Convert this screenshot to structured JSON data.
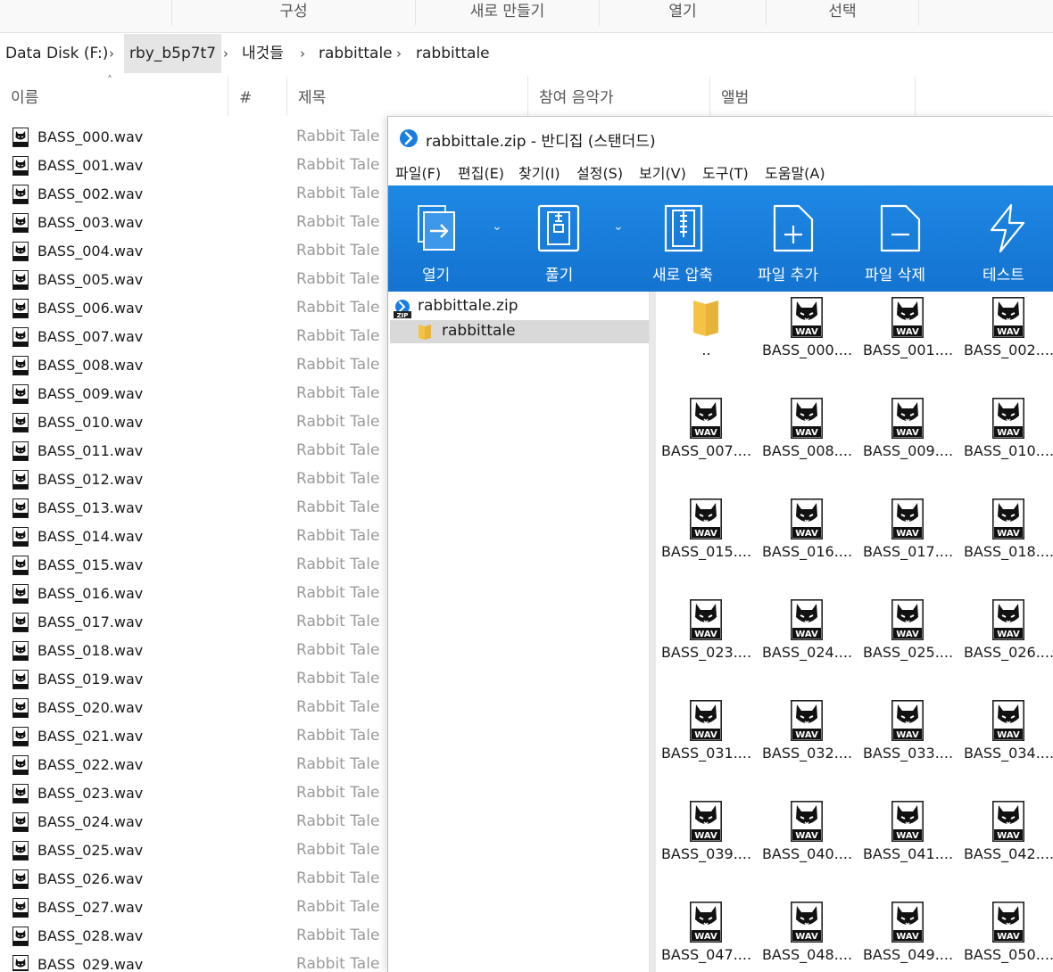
{
  "explorer": {
    "commands": [
      "구성",
      "새로 만들기",
      "열기",
      "선택"
    ],
    "breadcrumb": [
      "Data Disk (F:)",
      "rby_b5p7t7",
      "내것들",
      "rabbittale",
      "rabbittale"
    ],
    "columns": [
      "이름",
      "#",
      "제목",
      "참여 음악가",
      "앨범"
    ],
    "files": [
      {
        "name": "BASS_000.wav",
        "title": "Rabbit Tale"
      },
      {
        "name": "BASS_001.wav",
        "title": "Rabbit Tale"
      },
      {
        "name": "BASS_002.wav",
        "title": "Rabbit Tale"
      },
      {
        "name": "BASS_003.wav",
        "title": "Rabbit Tale"
      },
      {
        "name": "BASS_004.wav",
        "title": "Rabbit Tale"
      },
      {
        "name": "BASS_005.wav",
        "title": "Rabbit Tale"
      },
      {
        "name": "BASS_006.wav",
        "title": "Rabbit Tale"
      },
      {
        "name": "BASS_007.wav",
        "title": "Rabbit Tale"
      },
      {
        "name": "BASS_008.wav",
        "title": "Rabbit Tale"
      },
      {
        "name": "BASS_009.wav",
        "title": "Rabbit Tale"
      },
      {
        "name": "BASS_010.wav",
        "title": "Rabbit Tale"
      },
      {
        "name": "BASS_011.wav",
        "title": "Rabbit Tale"
      },
      {
        "name": "BASS_012.wav",
        "title": "Rabbit Tale"
      },
      {
        "name": "BASS_013.wav",
        "title": "Rabbit Tale"
      },
      {
        "name": "BASS_014.wav",
        "title": "Rabbit Tale"
      },
      {
        "name": "BASS_015.wav",
        "title": "Rabbit Tale"
      },
      {
        "name": "BASS_016.wav",
        "title": "Rabbit Tale"
      },
      {
        "name": "BASS_017.wav",
        "title": "Rabbit Tale"
      },
      {
        "name": "BASS_018.wav",
        "title": "Rabbit Tale"
      },
      {
        "name": "BASS_019.wav",
        "title": "Rabbit Tale"
      },
      {
        "name": "BASS_020.wav",
        "title": "Rabbit Tale"
      },
      {
        "name": "BASS_021.wav",
        "title": "Rabbit Tale"
      },
      {
        "name": "BASS_022.wav",
        "title": "Rabbit Tale"
      },
      {
        "name": "BASS_023.wav",
        "title": "Rabbit Tale"
      },
      {
        "name": "BASS_024.wav",
        "title": "Rabbit Tale"
      },
      {
        "name": "BASS_025.wav",
        "title": "Rabbit Tale"
      },
      {
        "name": "BASS_026.wav",
        "title": "Rabbit Tale"
      },
      {
        "name": "BASS_027.wav",
        "title": "Rabbit Tale"
      },
      {
        "name": "BASS_028.wav",
        "title": "Rabbit Tale"
      },
      {
        "name": "BASS_029.wav",
        "title": "Rabbit Tale"
      }
    ],
    "file_icon": "wav-file-icon"
  },
  "bandizip": {
    "title": "rabbittale.zip - 반디집 (스탠더드)",
    "menu": [
      "파일(F)",
      "편집(E)",
      "찾기(I)",
      "설정(S)",
      "보기(V)",
      "도구(T)",
      "도움말(A)"
    ],
    "toolbar": [
      {
        "label": "열기",
        "icon": "open-icon"
      },
      {
        "label": "풀기",
        "icon": "extract-icon"
      },
      {
        "label": "새로 압축",
        "icon": "new-archive-icon"
      },
      {
        "label": "파일 추가",
        "icon": "add-file-icon"
      },
      {
        "label": "파일 삭제",
        "icon": "delete-file-icon"
      },
      {
        "label": "테스트",
        "icon": "test-icon"
      }
    ],
    "tree": {
      "root": "rabbittale.zip",
      "child": "rabbittale"
    },
    "tiles": [
      "..",
      "BASS_000....",
      "BASS_001....",
      "BASS_002....",
      "BASS_007....",
      "BASS_008....",
      "BASS_009....",
      "BASS_010....",
      "BASS_015....",
      "BASS_016....",
      "BASS_017....",
      "BASS_018....",
      "BASS_023....",
      "BASS_024....",
      "BASS_025....",
      "BASS_026....",
      "BASS_031....",
      "BASS_032....",
      "BASS_033....",
      "BASS_034....",
      "BASS_039....",
      "BASS_040....",
      "BASS_041....",
      "BASS_042....",
      "BASS_047....",
      "BASS_048....",
      "BASS_049....",
      "BASS_050...."
    ],
    "wav_badge": "WAV",
    "colors": {
      "toolbar": "#1a7ee0",
      "selection": "#d9d9d9",
      "folder": "#f5c343"
    }
  }
}
